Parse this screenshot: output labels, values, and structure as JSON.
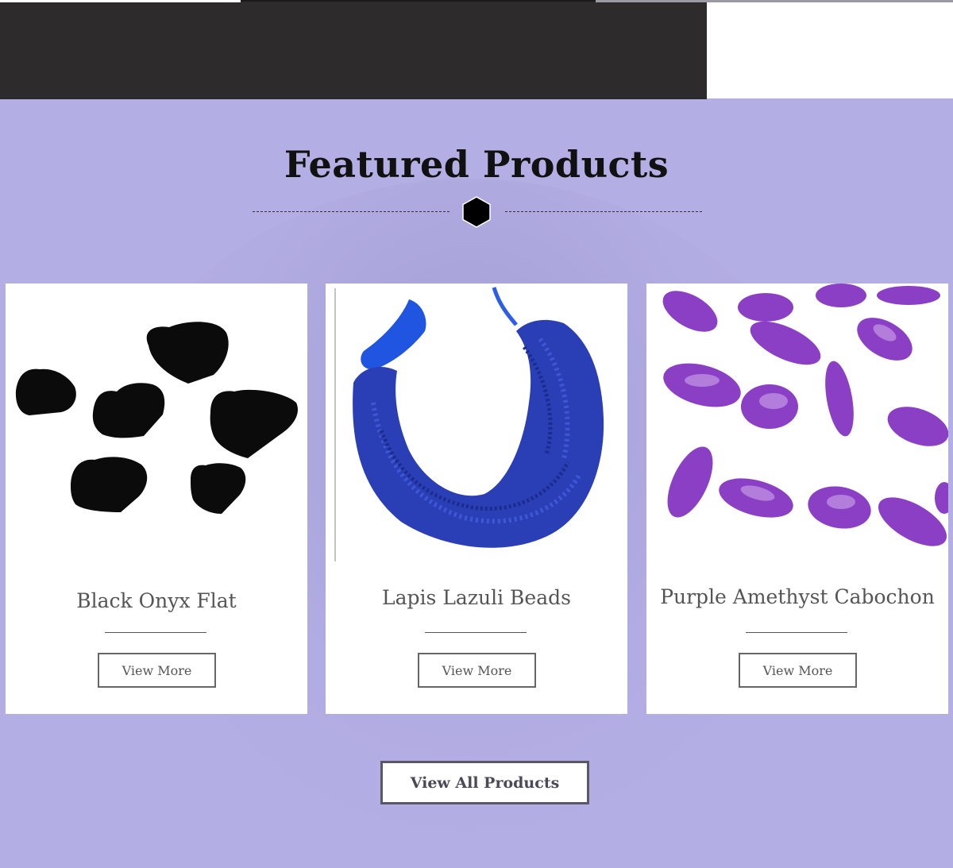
{
  "section": {
    "title": "Featured Products"
  },
  "products": [
    {
      "name": "Black Onyx Flat",
      "button": "View More"
    },
    {
      "name": "Lapis Lazuli Beads",
      "button": "View More"
    },
    {
      "name": "Purple Amethyst Cabochon",
      "button": "View More"
    }
  ],
  "view_all": {
    "label": "View All Products"
  },
  "colors": {
    "section_bg": "#b3aee3",
    "top_dark": "#2d2b2b",
    "onyx": "#0b0b0b",
    "lapis": "#2a3fb5",
    "amethyst": "#8a3fc4"
  },
  "icons": {
    "divider": "hexagon-icon"
  }
}
